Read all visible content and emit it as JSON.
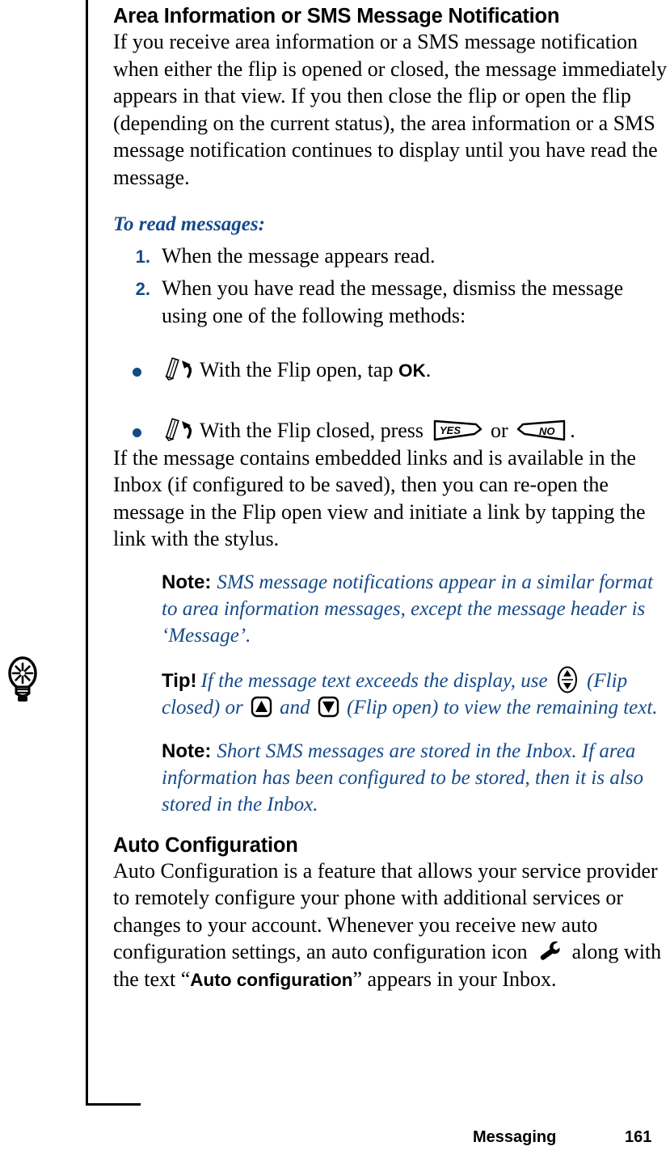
{
  "page": {
    "heading_main": "Area Information or SMS Message Notification",
    "intro_paragraph": "If you receive area information or a SMS message notification when either the flip is opened or closed, the message immediately appears in that view. If you then close the flip or open the flip (depending on the current status), the area information or a SMS message notification continues to display until you have read the message.",
    "subhead": "To read messages:",
    "steps": [
      {
        "number": "1.",
        "text": "When the message appears read."
      },
      {
        "number": "2.",
        "text": "When you have read the message, dismiss the message using one of the following methods:"
      }
    ],
    "bullets": [
      {
        "icon": "stylus-tap-icon",
        "text_before": "With the Flip open, tap ",
        "ui_label": "OK",
        "text_after": "."
      },
      {
        "icon": "stylus-tap-icon",
        "text_before": "With the Flip closed, press ",
        "key_yes": "YES",
        "text_middle": " or ",
        "key_no": "NO",
        "text_after": "."
      }
    ],
    "links_paragraph": "If the message contains embedded links and is available in the Inbox (if configured to be saved), then you can re-open the message in the Flip open view and initiate a link by tapping the link with the stylus.",
    "note_one": {
      "label": "Note:",
      "text": "SMS message notifications appear in a similar format to area information messages, except the message header is ‘Message’."
    },
    "tip": {
      "label": "Tip!",
      "text_1": "If the message text exceeds the display, use ",
      "icon_1": "updown-key-icon",
      "text_2": " (Flip closed) or ",
      "icon_2": "up-arrow-key-icon",
      "text_3": " and ",
      "icon_3": "down-arrow-key-icon",
      "text_4": " (Flip open) to view the remaining text."
    },
    "note_two": {
      "label": "Note:",
      "text": "Short SMS messages are stored in the Inbox. If area information has been configured to be stored, then it is also stored in the Inbox."
    },
    "heading_auto": "Auto Configuration",
    "auto_paragraph": {
      "text_1": "Auto Configuration is a feature that allows your service provider to remotely configure your phone with additional services or changes to your account. Whenever you receive new auto configuration settings, an auto configuration icon ",
      "icon": "wrench-icon",
      "text_2": " along with the text “",
      "ui_label": "Auto configuration",
      "text_3": "” appears in your Inbox."
    },
    "margin_icon": "light-bulb-tip-icon",
    "footer": {
      "section": "Messaging",
      "page_number": "161"
    },
    "colors": {
      "accent_blue": "#154a8a",
      "number_blue": "#134a86",
      "text_black": "#000000",
      "background": "#ffffff"
    }
  }
}
